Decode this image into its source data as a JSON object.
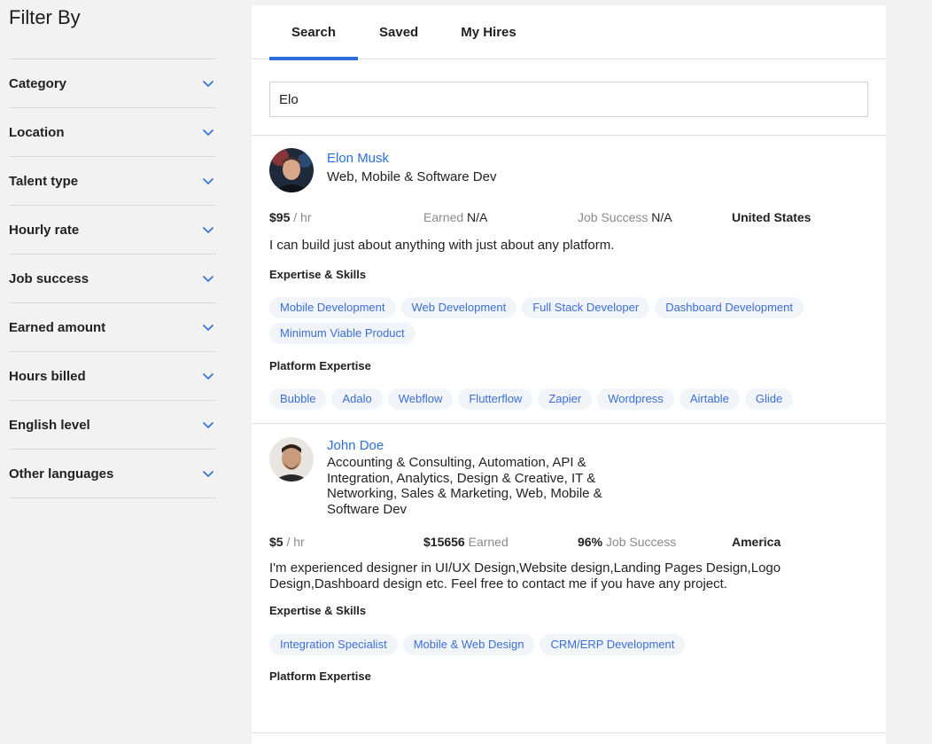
{
  "sidebar": {
    "title": "Filter By",
    "filters": [
      {
        "label": "Category"
      },
      {
        "label": "Location"
      },
      {
        "label": "Talent type"
      },
      {
        "label": "Hourly rate"
      },
      {
        "label": "Job success"
      },
      {
        "label": "Earned amount"
      },
      {
        "label": "Hours billed"
      },
      {
        "label": "English level"
      },
      {
        "label": "Other languages"
      }
    ]
  },
  "tabs": [
    {
      "label": "Search",
      "active": true
    },
    {
      "label": "Saved",
      "active": false
    },
    {
      "label": "My Hires",
      "active": false
    }
  ],
  "search": {
    "value": "Elo"
  },
  "accent_color": "#2a6fdb",
  "freelancers": [
    {
      "name": "Elon Musk",
      "headline": "Web, Mobile & Software Dev",
      "rate": "$95",
      "rate_unit": " / hr",
      "earned_label": "Earned ",
      "earned_value": "N/A",
      "success_label": "Job Success ",
      "success_value": "N/A",
      "country": "United States",
      "description": "I can build just about anything with just about any platform.",
      "skills_label": "Expertise & Skills",
      "skills": [
        "Mobile Development",
        "Web Development",
        "Full Stack Developer",
        "Dashboard Development",
        "Minimum Viable Product"
      ],
      "platform_label": "Platform Expertise",
      "platforms": [
        "Bubble",
        "Adalo",
        "Webflow",
        "Flutterflow",
        "Zapier",
        "Wordpress",
        "Airtable",
        "Glide"
      ]
    },
    {
      "name": "John Doe",
      "headline": "Accounting & Consulting, Automation, API & Integration, Analytics, Design & Creative, IT & Networking, Sales & Marketing, Web, Mobile & Software Dev",
      "rate": "$5",
      "rate_unit": " / hr",
      "earned_value": "$15656",
      "earned_label": " Earned",
      "success_value": "96%",
      "success_label": " Job Success",
      "country": "America",
      "description": "I'm experienced designer in UI/UX Design,Website design,Landing Pages Design,Logo Design,Dashboard design etc. Feel free to contact me if you have any project.",
      "skills_label": "Expertise & Skills",
      "skills": [
        "Integration Specialist",
        "Mobile & Web Design",
        "CRM/ERP Development"
      ],
      "platform_label": "Platform Expertise",
      "platforms": []
    }
  ]
}
